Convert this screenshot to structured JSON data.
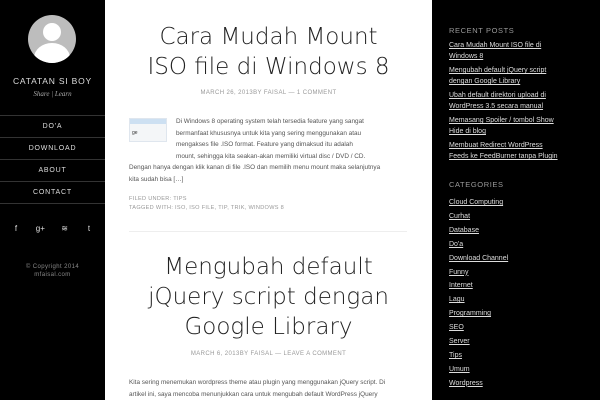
{
  "site": {
    "title": "Catatan Si Boy",
    "description": "Share | Learn",
    "copyright_line1": "© Copyright 2014",
    "copyright_line2": "mfaisal.com"
  },
  "nav": {
    "items": [
      "Do'a",
      "Download",
      "About",
      "Contact"
    ]
  },
  "social": {
    "icons": [
      "facebook-icon",
      "google-plus-icon",
      "rss-icon",
      "twitter-icon"
    ],
    "glyphs": [
      "f",
      "g+",
      "≋",
      "t"
    ]
  },
  "posts": [
    {
      "title_line1": "Cara Mudah Mount",
      "title_line2": "ISO file di Windows 8",
      "meta": "March 26, 2013By Faisal — 1 Comment",
      "thumb_label": "ge",
      "excerpt_lines": [
        "Di Windows 8 operating system telah tersedia feature yang sangat",
        "bermanfaat khususnya untuk kita yang sering menggunakan atau",
        "mengakses file .ISO format. Feature yang dimaksud itu adalah",
        "mount, sehingga kita seakan-akan memiliki virtual disc / DVD / CD.",
        "Dengan hanya dengan klik kanan di file .ISO dan memilih menu mount maka selanjutnya",
        "kita sudah bisa […]"
      ],
      "filed": "Filed Under: Tips",
      "tagged": "Tagged With: ISO, ISO file, Tip, Trik, Windows 8"
    },
    {
      "title_line1": "Mengubah default",
      "title_line2": "jQuery script dengan",
      "title_line3": "Google Library",
      "meta": "March 6, 2013By Faisal — Leave a Comment",
      "excerpt_lines": [
        "Kita sering menemukan wordpress theme atau plugin yang menggunakan jQuery script. Di",
        "artikel ini, saya mencoba menunjukkan cara untuk mengubah default WordPress jQuery"
      ]
    }
  ],
  "sidebar": {
    "recent_title": "Recent Posts",
    "recent": [
      [
        "Cara Mudah Mount ISO file di",
        "Windows 8"
      ],
      [
        "Mengubah default jQuery script",
        "dengan Google Library"
      ],
      [
        "Ubah default direktori upload di",
        "WordPress 3.5 secara manual"
      ],
      [
        "Memasang Spoiler / tombol Show",
        "Hide di blog"
      ],
      [
        "Membuat Redirect WordPress",
        "Feeds ke FeedBurner tanpa Plugin"
      ]
    ],
    "categories_title": "Categories",
    "categories": [
      "Cloud Computing",
      "Curhat",
      "Database",
      "Do'a",
      "Download Channel",
      "Funny",
      "Internet",
      "Lagu",
      "Programming",
      "SEO",
      "Server",
      "Tips",
      "Umum",
      "Wordpress"
    ]
  }
}
